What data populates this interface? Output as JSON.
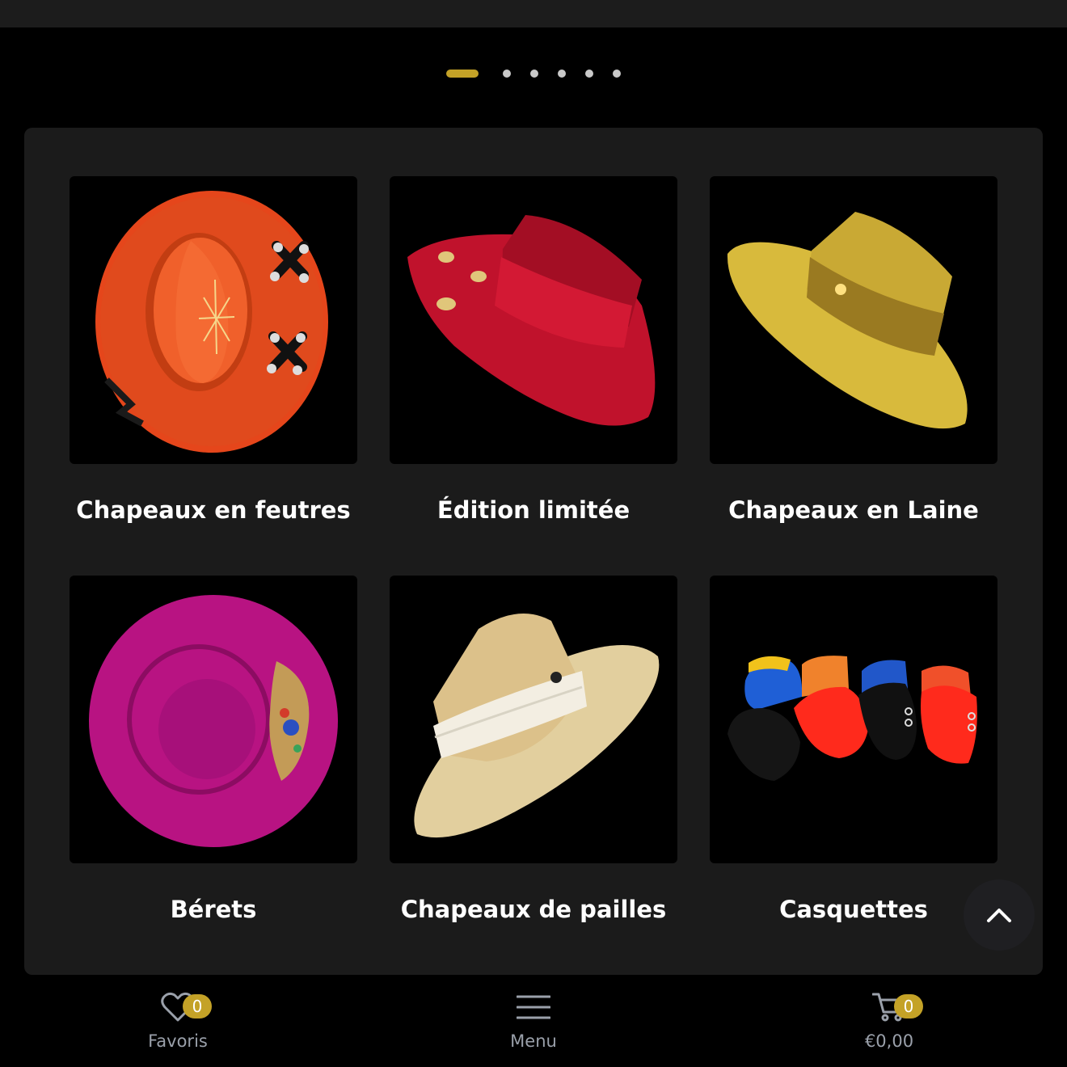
{
  "carousel": {
    "slides": 6,
    "active": 0
  },
  "categories": [
    {
      "label": "Chapeaux en feutres",
      "image": "orange-felt-hat-image"
    },
    {
      "label": "Édition limitée",
      "image": "red-boater-hat-image"
    },
    {
      "label": "Chapeaux en Laine",
      "image": "yellow-wool-hat-image"
    },
    {
      "label": "Bérets",
      "image": "magenta-beret-image"
    },
    {
      "label": "Chapeaux de pailles",
      "image": "straw-hat-image"
    },
    {
      "label": "Casquettes",
      "image": "caps-image"
    }
  ],
  "bottom_nav": {
    "favoris": {
      "label": "Favoris",
      "count": "0",
      "icon": "heart-icon"
    },
    "menu": {
      "label": "Menu",
      "icon": "hamburger-icon"
    },
    "cart": {
      "label": "€0,00",
      "count": "0",
      "icon": "cart-icon"
    }
  },
  "colors": {
    "accent": "#c4a227",
    "panel": "#1b1b1b",
    "background": "#000000"
  }
}
